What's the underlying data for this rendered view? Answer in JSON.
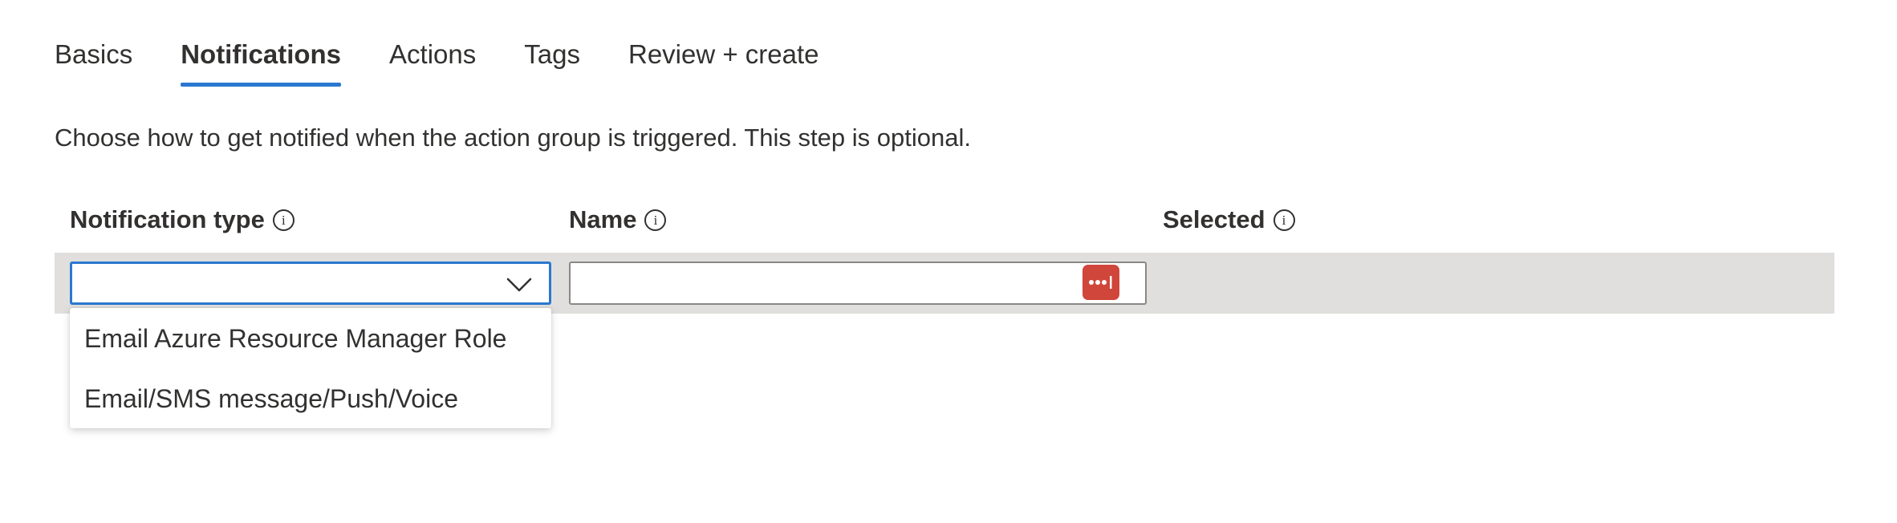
{
  "tabs": [
    {
      "label": "Basics",
      "active": false
    },
    {
      "label": "Notifications",
      "active": true
    },
    {
      "label": "Actions",
      "active": false
    },
    {
      "label": "Tags",
      "active": false
    },
    {
      "label": "Review + create",
      "active": false
    }
  ],
  "description": "Choose how to get notified when the action group is triggered. This step is optional.",
  "columns": {
    "notification_type": "Notification type",
    "name": "Name",
    "selected": "Selected"
  },
  "row": {
    "notification_type_value": "",
    "name_value": ""
  },
  "dropdown_options": [
    "Email Azure Resource Manager Role",
    "Email/SMS message/Push/Voice"
  ],
  "colors": {
    "accent": "#2b78d0",
    "row_background": "#e1dfdd",
    "password_manager_badge": "#d0463b"
  },
  "icons": {
    "info": "info-icon",
    "dropdown": "chevron-down-icon",
    "password_manager": "password-manager-icon"
  }
}
